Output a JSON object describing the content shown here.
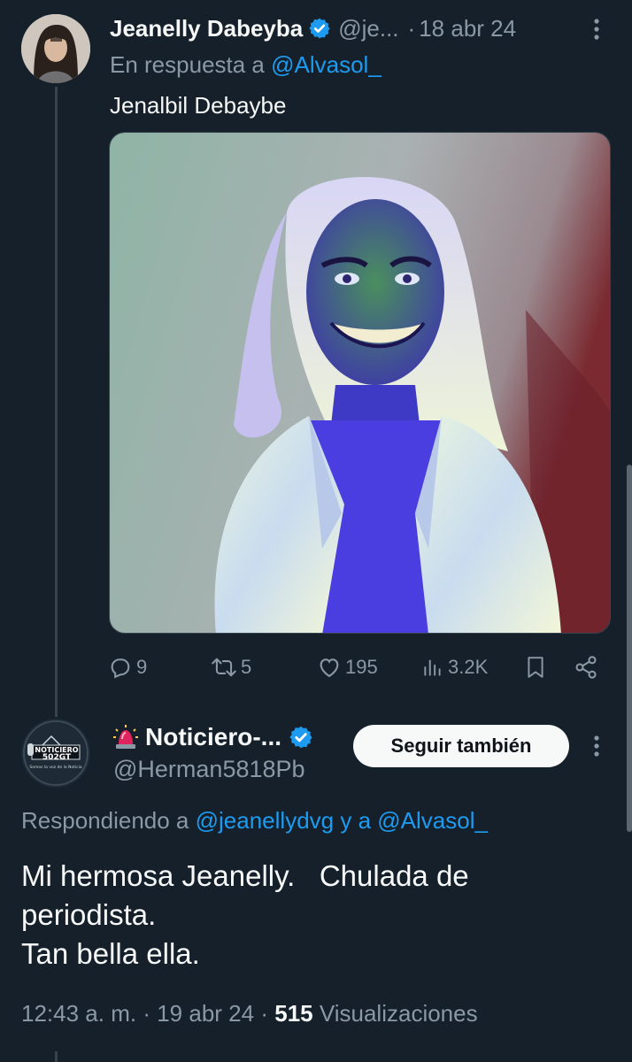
{
  "tweet1": {
    "author_name": "Jeanelly Dabeyba",
    "handle": "@je...",
    "separator": "·",
    "date": "18 abr 24",
    "reply_prefix": "En respuesta a",
    "reply_to": "@Alvasol_",
    "text": "Jenalbil Debaybe",
    "stats": {
      "replies": "9",
      "retweets": "5",
      "likes": "195",
      "views": "3.2K"
    }
  },
  "tweet2": {
    "author_name": "Noticiero-...",
    "handle": "@Herman5818Pb",
    "follow_label": "Seguir también",
    "reply_prefix": "Respondiendo a",
    "reply_to_1": "@jeanellydvg",
    "reply_conjunction": "y a",
    "reply_to_2": "@Alvasol_",
    "body_lines": [
      "Mi hermosa Jeanelly.   Chulada de",
      "periodista.",
      "Tan bella ella."
    ],
    "time": "12:43 a. m.",
    "date": "19 abr 24",
    "separator": "·",
    "views_count": "515",
    "views_label": "Visualizaciones",
    "avatar_logo": {
      "line1": "NOTICIERO",
      "line2": "502GT",
      "tagline": "Somos la voz de la Noticia"
    }
  },
  "colors": {
    "background": "#15202b",
    "text": "#f7f9f9",
    "muted": "#8b98a5",
    "accent": "#1d9bf0"
  },
  "icons": [
    "verified-badge-icon",
    "more-icon",
    "reply-icon",
    "retweet-icon",
    "like-icon",
    "views-icon",
    "bookmark-icon",
    "share-icon",
    "siren-icon"
  ]
}
